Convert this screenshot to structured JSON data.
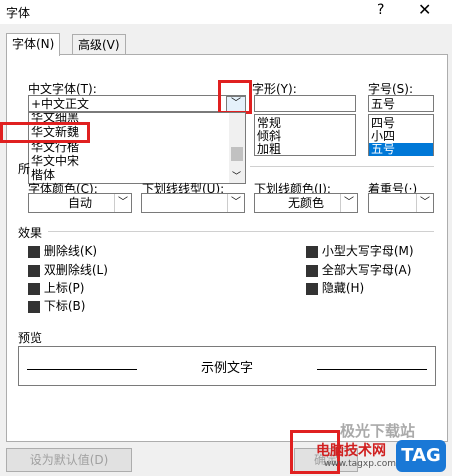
{
  "window": {
    "title": "字体",
    "help": "?",
    "close": "✕"
  },
  "tabs": [
    {
      "label": "字体(N)"
    },
    {
      "label": "高级(V)"
    }
  ],
  "chinese_font": {
    "label": "中文字体(T):",
    "value": "+中文正文",
    "options": [
      "华文细黑",
      "华文新魏",
      "华文行楷",
      "华文中宋",
      "楷体"
    ],
    "highlighted": "华文新魏"
  },
  "style": {
    "label": "字形(Y):",
    "value": "",
    "options": [
      "常规",
      "倾斜",
      "加粗"
    ]
  },
  "size": {
    "label": "字号(S):",
    "value": "五号",
    "options": [
      "四号",
      "小四",
      "五号"
    ],
    "selected": "五号"
  },
  "partial_label": "所",
  "font_color": {
    "label": "字体颜色(C):",
    "value": "自动"
  },
  "underline_style": {
    "label": "下划线线型(U):",
    "value": ""
  },
  "underline_color": {
    "label": "下划线颜色(I):",
    "value": "无颜色"
  },
  "emphasis": {
    "label": "着重号(·)",
    "value": ""
  },
  "effects": {
    "title": "效果",
    "left": [
      "删除线(K)",
      "双删除线(L)",
      "上标(P)",
      "下标(B)"
    ],
    "right": [
      "小型大写字母(M)",
      "全部大写字母(A)",
      "隐藏(H)"
    ]
  },
  "preview": {
    "title": "预览",
    "sample": "示例文字"
  },
  "buttons": {
    "default": "设为默认值(D)",
    "ok": "确定"
  },
  "watermark": {
    "text": "电脑技术网",
    "url": "www.tagxp.com",
    "tag": "TAG",
    "top": "极光下载站"
  },
  "colors": {
    "accent": "#0078d7",
    "highlight": "#e02020"
  }
}
